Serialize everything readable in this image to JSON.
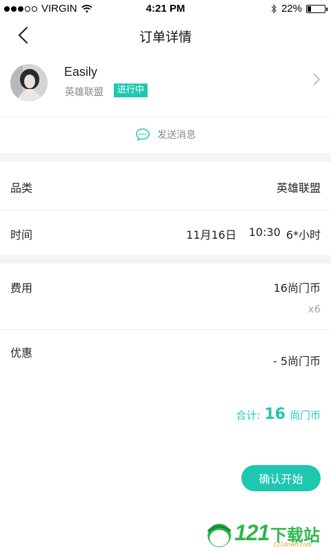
{
  "status_bar": {
    "carrier": "VIRGIN",
    "time": "4:21 PM",
    "battery": "22%",
    "battery_level": 0.22,
    "signal_bars": 3,
    "signal_total": 5
  },
  "nav": {
    "title": "订单详情",
    "back_icon": "chevron-left-icon"
  },
  "user": {
    "name": "Easily",
    "game": "英雄联盟",
    "status": "进行中"
  },
  "message": {
    "label": "发送消息",
    "icon": "chat-bubble-icon"
  },
  "details": {
    "category_label": "品类",
    "category_value": "英雄联盟",
    "time_label": "时间",
    "time_date": "11月16日",
    "time_clock": "10:30",
    "time_duration": "6*小时"
  },
  "fees": {
    "fee_label": "费用",
    "fee_value": "16尚门币",
    "fee_multiplier": "x6",
    "discount_label": "优惠",
    "discount_value": "- 5尚门币"
  },
  "total": {
    "label": "合计:",
    "amount": "16",
    "unit": "尚门币"
  },
  "actions": {
    "confirm_label": "确认开始"
  },
  "watermark": {
    "number": "121",
    "text": "下载站",
    "domain": "121down.com"
  },
  "colors": {
    "accent": "#1ec8b0",
    "watermark_green": "#2db84b"
  }
}
